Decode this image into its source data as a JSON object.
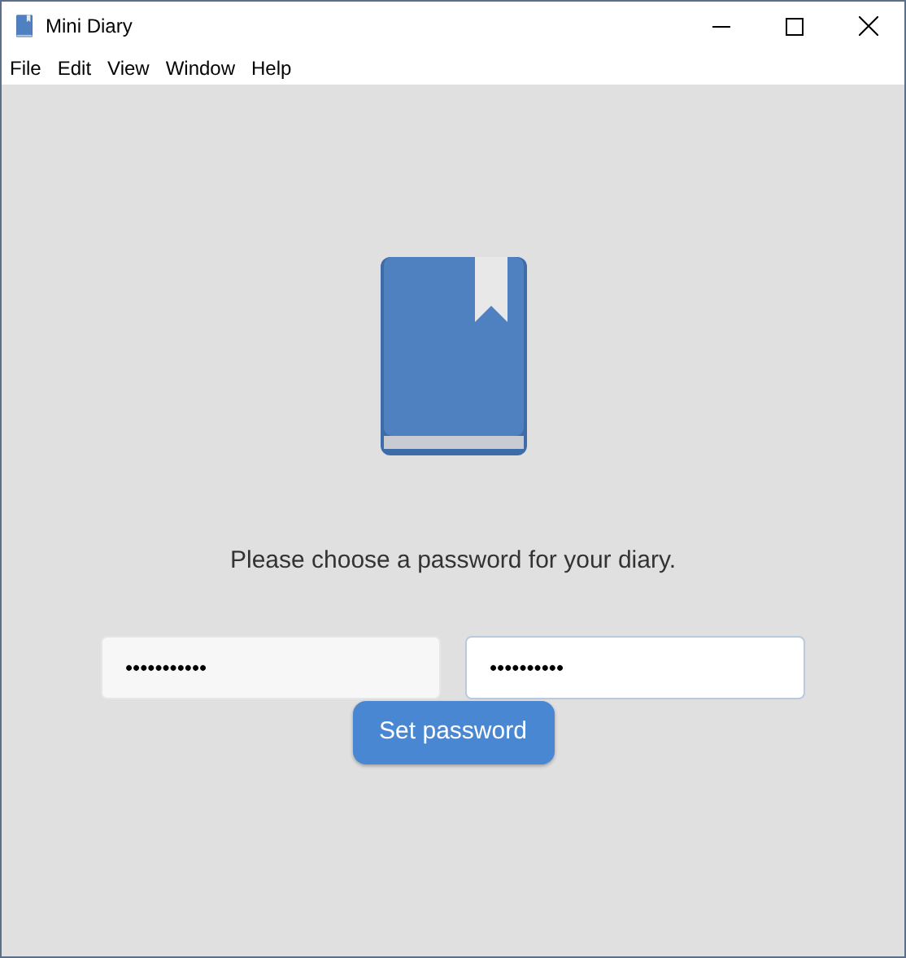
{
  "window": {
    "title": "Mini Diary"
  },
  "menu": [
    "File",
    "Edit",
    "View",
    "Window",
    "Help"
  ],
  "prompt": "Please choose a password for your diary.",
  "fields": [
    {
      "value": "•••••••••••",
      "focused": false
    },
    {
      "value": "••••••••••",
      "focused": true
    }
  ],
  "button": "Set password"
}
